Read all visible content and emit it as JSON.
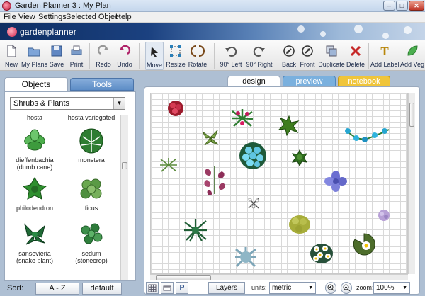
{
  "window": {
    "title": "Garden Planner 3 : My  Plan",
    "min": "–",
    "max": "□",
    "close": "✕"
  },
  "menu": [
    "File",
    "View",
    "Settings",
    "Selected Object",
    "Help"
  ],
  "banner": {
    "logo": "gardenplanner"
  },
  "toolbar": [
    {
      "id": "new",
      "label": "New",
      "icon": "new-document-icon"
    },
    {
      "id": "myplans",
      "label": "My Plans",
      "icon": "folder-icon"
    },
    {
      "id": "save",
      "label": "Save",
      "icon": "save-icon"
    },
    {
      "id": "print",
      "label": "Print",
      "icon": "printer-icon"
    },
    {
      "id": "redo",
      "label": "Redo",
      "icon": "redo-icon"
    },
    {
      "id": "undo",
      "label": "Undo",
      "icon": "undo-icon"
    },
    {
      "id": "move",
      "label": "Move",
      "icon": "cursor-arrow-icon"
    },
    {
      "id": "resize",
      "label": "Resize",
      "icon": "resize-handles-icon"
    },
    {
      "id": "rotate",
      "label": "Rotate",
      "icon": "rotate-icon"
    },
    {
      "id": "left90",
      "label": "90° Left",
      "icon": "rotate-left-icon"
    },
    {
      "id": "right90",
      "label": "90° Right",
      "icon": "rotate-right-icon"
    },
    {
      "id": "back",
      "label": "Back",
      "icon": "send-back-icon"
    },
    {
      "id": "front",
      "label": "Front",
      "icon": "bring-front-icon"
    },
    {
      "id": "duplicate",
      "label": "Duplicate",
      "icon": "duplicate-icon"
    },
    {
      "id": "delete",
      "label": "Delete",
      "icon": "delete-x-icon"
    },
    {
      "id": "addlabel",
      "label": "Add Label",
      "icon": "text-label-icon"
    },
    {
      "id": "addveg",
      "label": "Add Veg",
      "icon": "leaf-icon"
    }
  ],
  "left_panel": {
    "tabs": {
      "objects": "Objects",
      "tools": "Tools"
    },
    "category": "Shrubs & Plants",
    "plants": [
      {
        "name": "hosta",
        "color": "#3c8a3c"
      },
      {
        "name": "hosta variegated",
        "color": "#7fb05a"
      },
      {
        "name": "dieffenbachia\n(dumb cane)",
        "color": "#3a9a3a"
      },
      {
        "name": "monstera",
        "color": "#2e7d32"
      },
      {
        "name": "philodendron",
        "color": "#2f7f2f"
      },
      {
        "name": "ficus",
        "color": "#4f8f3f"
      },
      {
        "name": "sansevieria\n(snake plant)",
        "color": "#1f6a35"
      },
      {
        "name": "sedum\n(stonecrop)",
        "color": "#2d7a3a"
      }
    ],
    "sort": {
      "label": "Sort:",
      "az": "A - Z",
      "default": "default"
    }
  },
  "view_tabs": {
    "design": "design",
    "preview": "preview",
    "notebook": "notebook"
  },
  "bottom_bar": {
    "layers": "Layers",
    "units_label": "units:",
    "units_value": "metric",
    "zoom_label": "zoom:",
    "zoom_value": "100%",
    "plan_toggle": "P"
  },
  "colors": {
    "tools_tab": "#6b96cc",
    "preview_tab": "#7ab0de",
    "notebook_tab": "#f0c53a",
    "accent": "#1b4180"
  }
}
